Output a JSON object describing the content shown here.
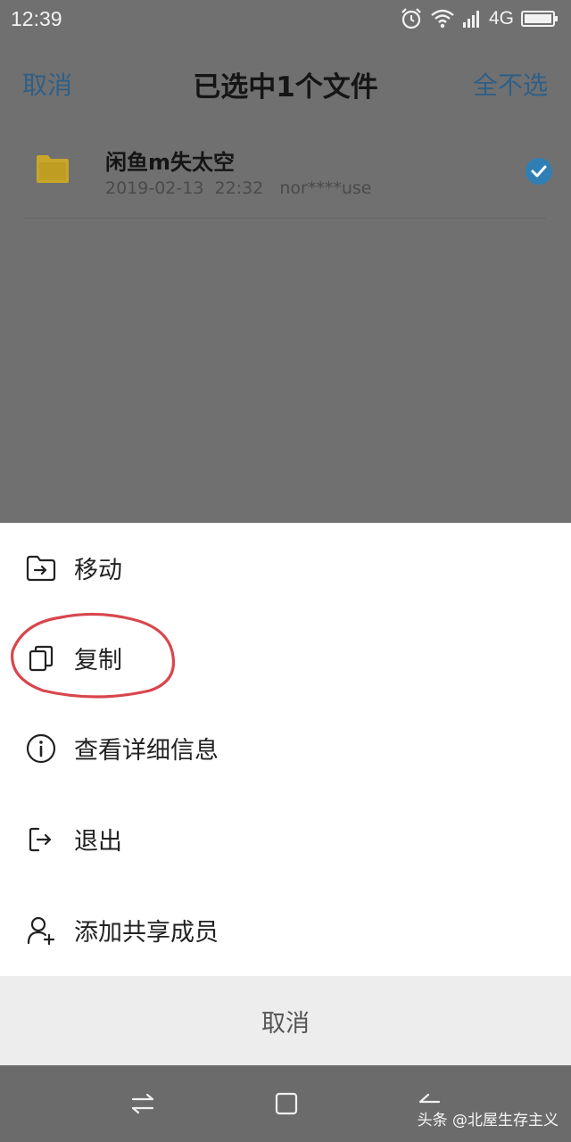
{
  "status_bar": {
    "time": "12:39",
    "network": "4G",
    "icons": [
      "alarm-icon",
      "wifi-icon",
      "signal-icon",
      "battery-icon"
    ]
  },
  "header": {
    "cancel_label": "取消",
    "title": "已选中1个文件",
    "deselect_all_label": "全不选"
  },
  "file": {
    "name": "闲鱼m失太空",
    "meta": "2019-02-13  22:32   nor****use",
    "selected": true,
    "icon": "folder-icon"
  },
  "menu": {
    "items": [
      {
        "label": "移动",
        "icon": "move-to-folder-icon"
      },
      {
        "label": "复制",
        "icon": "copy-icon"
      },
      {
        "label": "查看详细信息",
        "icon": "info-icon"
      },
      {
        "label": "退出",
        "icon": "exit-icon"
      },
      {
        "label": "添加共享成员",
        "icon": "add-member-icon"
      }
    ],
    "cancel_label": "取消"
  },
  "nav_bar": {
    "buttons": [
      "switch-icon",
      "home-square-icon",
      "back-icon"
    ]
  },
  "watermark": "头条 @北屋生存主义",
  "colors": {
    "overlay": "#707070",
    "accent_link": "#2f5f86",
    "check": "#2f7fb5",
    "folder": "#c9a62a",
    "annotation": "#d9464d"
  }
}
